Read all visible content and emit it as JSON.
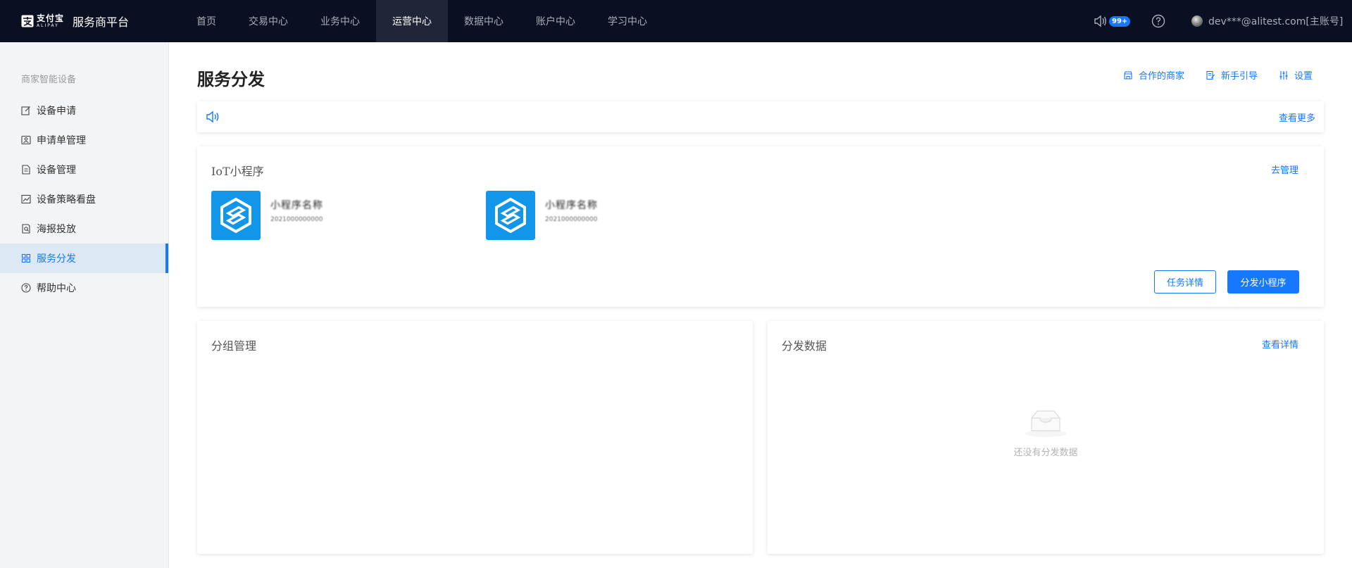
{
  "brand": {
    "logo_cn": "支付宝",
    "logo_en": "ALIPAY",
    "platform": "服务商平台"
  },
  "nav": [
    {
      "label": "首页",
      "active": false
    },
    {
      "label": "交易中心",
      "active": false
    },
    {
      "label": "业务中心",
      "active": false
    },
    {
      "label": "运营中心",
      "active": true
    },
    {
      "label": "数据中心",
      "active": false
    },
    {
      "label": "账户中心",
      "active": false
    },
    {
      "label": "学习中心",
      "active": false
    }
  ],
  "topright": {
    "badge": "99+",
    "user": "dev***@alitest.com[主账号]"
  },
  "sidebar": {
    "group": "商家智能设备",
    "items": [
      {
        "label": "设备申请",
        "icon": "edit-icon"
      },
      {
        "label": "申请单管理",
        "icon": "id-card-icon"
      },
      {
        "label": "设备管理",
        "icon": "document-icon"
      },
      {
        "label": "设备策略看盘",
        "icon": "chart-icon"
      },
      {
        "label": "海报投放",
        "icon": "poster-icon"
      },
      {
        "label": "服务分发",
        "icon": "grid-icon",
        "active": true
      },
      {
        "label": "帮助中心",
        "icon": "help-icon"
      }
    ]
  },
  "page": {
    "title": "服务分发",
    "links": [
      "合作的商家",
      "新手引导",
      "设置"
    ]
  },
  "notice": {
    "more": "查看更多"
  },
  "iot": {
    "title": "IoT小程序",
    "manage": "去管理",
    "apps": [
      {
        "name": "小程序名称",
        "sub": "2021000000000"
      },
      {
        "name": "小程序名称",
        "sub": "2021000000000"
      }
    ],
    "task_detail": "任务详情",
    "distribute": "分发小程序"
  },
  "group": {
    "title": "分组管理"
  },
  "dist": {
    "title": "分发数据",
    "detail": "查看详情",
    "empty": "还没有分发数据"
  },
  "colors": {
    "topbar": "#0a1021",
    "accent": "#1677ff",
    "app_icon": "#1296ea"
  }
}
